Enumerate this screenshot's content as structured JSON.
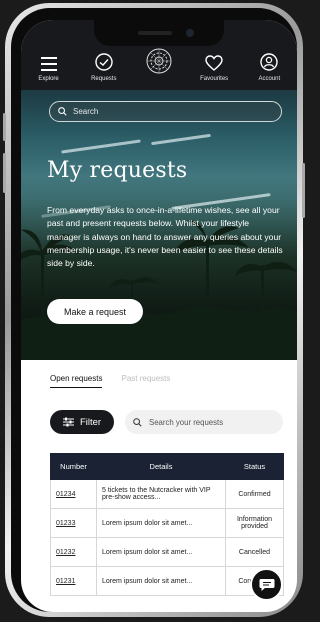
{
  "nav": {
    "items": [
      {
        "label": "Explore",
        "icon": "menu-icon"
      },
      {
        "label": "Requests",
        "icon": "check-circle-icon"
      },
      {
        "label": "",
        "icon": "logo-emblem-icon"
      },
      {
        "label": "Favourites",
        "icon": "heart-icon"
      },
      {
        "label": "Account",
        "icon": "user-circle-icon"
      }
    ]
  },
  "search": {
    "placeholder": "Search"
  },
  "hero": {
    "title": "My requests",
    "text": "From everyday asks to once-in-a-lifetime wishes, see all your past and present requests below. Whilst your lifestyle manager is always on hand to answer any queries about your membership usage, it's never been easier to see these details side by side.",
    "button_label": "Make a request"
  },
  "tabs": {
    "open": "Open requests",
    "past": "Past requests"
  },
  "filter": {
    "label": "Filter"
  },
  "request_search": {
    "placeholder": "Search your requests"
  },
  "table": {
    "headers": [
      "Number",
      "Details",
      "Status"
    ],
    "rows": [
      {
        "number": "01234",
        "details": "5 tickets to the Nutcracker with VIP pre-show access...",
        "status": "Confirmed"
      },
      {
        "number": "01233",
        "details": "Lorem ipsum dolor sit amet...",
        "status": "Information provided"
      },
      {
        "number": "01232",
        "details": "Lorem ipsum dolor sit amet...",
        "status": "Cancelled"
      },
      {
        "number": "01231",
        "details": "Lorem ipsum dolor sit amet...",
        "status": "Confirmed"
      }
    ]
  },
  "chat": {
    "icon": "chat-bubble-icon"
  },
  "colors": {
    "nav_bg": "#17191c",
    "table_header": "#1a2233",
    "accent": "#ffffff"
  }
}
